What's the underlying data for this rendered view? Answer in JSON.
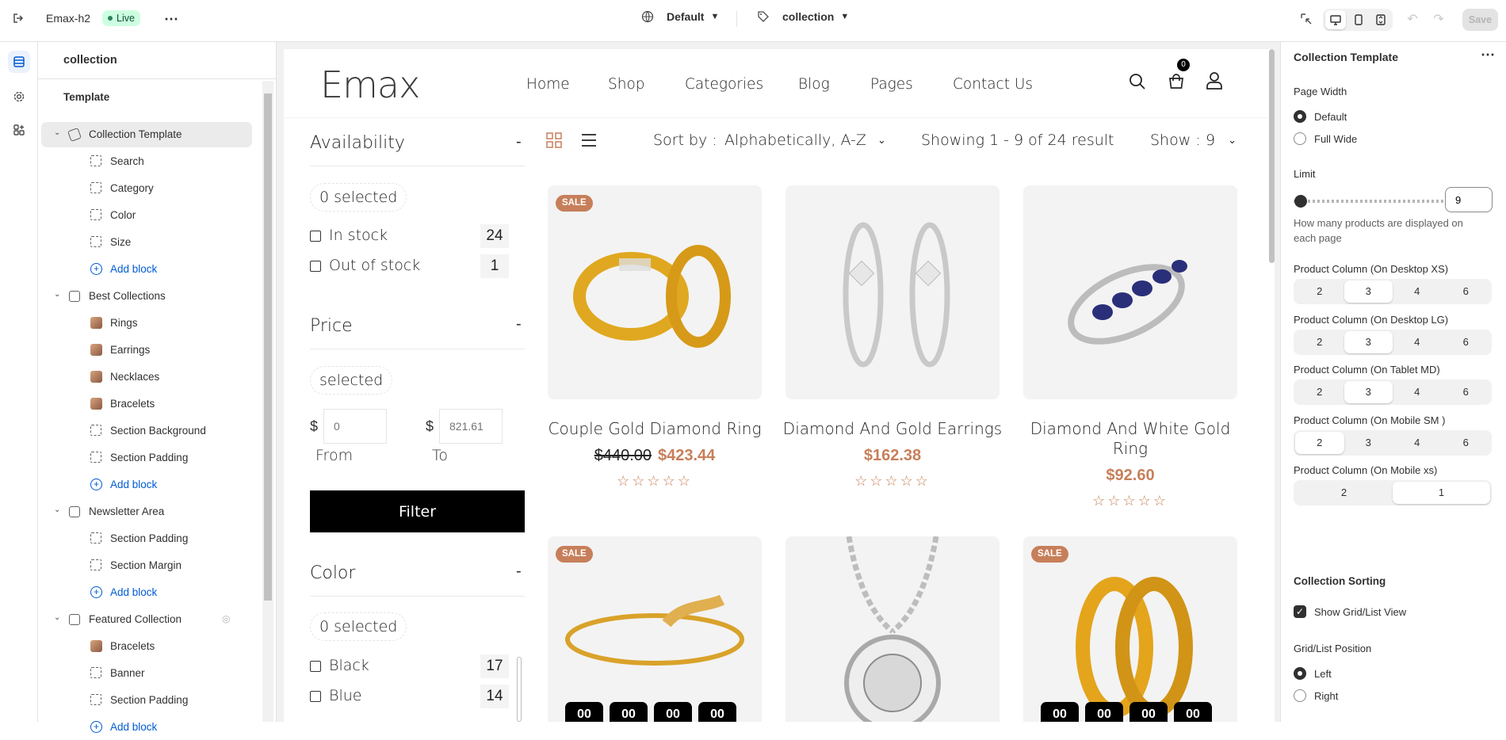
{
  "topbar": {
    "store_name": "Emax-h2",
    "live_badge": "Live",
    "theme_dropdown": "Default",
    "template_dropdown": "collection",
    "save_label": "Save"
  },
  "tree": {
    "header": "collection",
    "section_label": "Template",
    "items": [
      {
        "label": "Collection Template",
        "kind": "section"
      },
      {
        "label": "Search",
        "kind": "block"
      },
      {
        "label": "Category",
        "kind": "block"
      },
      {
        "label": "Color",
        "kind": "block"
      },
      {
        "label": "Size",
        "kind": "block"
      },
      {
        "label": "Add block",
        "kind": "add"
      },
      {
        "label": "Best Collections",
        "kind": "section"
      },
      {
        "label": "Rings",
        "kind": "thumb"
      },
      {
        "label": "Earrings",
        "kind": "thumb"
      },
      {
        "label": "Necklaces",
        "kind": "thumb"
      },
      {
        "label": "Bracelets",
        "kind": "thumb"
      },
      {
        "label": "Section Background",
        "kind": "block"
      },
      {
        "label": "Section Padding",
        "kind": "block"
      },
      {
        "label": "Add block",
        "kind": "add"
      },
      {
        "label": "Newsletter Area",
        "kind": "section"
      },
      {
        "label": "Section Padding",
        "kind": "block"
      },
      {
        "label": "Section Margin",
        "kind": "block"
      },
      {
        "label": "Add block",
        "kind": "add"
      },
      {
        "label": "Featured Collection",
        "kind": "section"
      },
      {
        "label": "Bracelets",
        "kind": "thumb"
      },
      {
        "label": "Banner",
        "kind": "block"
      },
      {
        "label": "Section Padding",
        "kind": "block"
      },
      {
        "label": "Add block",
        "kind": "add"
      }
    ]
  },
  "store": {
    "logo": "Emax",
    "nav": [
      "Home",
      "Shop",
      "Categories",
      "Blog",
      "Pages",
      "Contact Us"
    ],
    "cart_count": "0",
    "sort_label": "Sort by :",
    "sort_value": "Alphabetically, A-Z",
    "showing": "Showing 1 - 9 of 24 result",
    "show_label": "Show :",
    "show_value": "9",
    "filters": {
      "availability": {
        "title": "Availability",
        "toggle": "-",
        "selected": "0 selected",
        "options": [
          {
            "label": "In stock",
            "count": "24"
          },
          {
            "label": "Out of stock",
            "count": "1"
          }
        ]
      },
      "price": {
        "title": "Price",
        "toggle": "-",
        "selected": "selected",
        "currency": "$",
        "from_placeholder": "0",
        "to_placeholder": "821.61",
        "from_label": "From",
        "to_label": "To",
        "filter_button": "Filter"
      },
      "color": {
        "title": "Color",
        "toggle": "-",
        "selected": "0 selected",
        "options": [
          {
            "label": "Black",
            "count": "17"
          },
          {
            "label": "Blue",
            "count": "14"
          }
        ]
      }
    },
    "products": [
      {
        "title": "Couple Gold Diamond Ring",
        "old_price": "$440.00",
        "price": "$423.44",
        "sale": "SALE"
      },
      {
        "title": "Diamond And Gold Earrings",
        "old_price": "",
        "price": "$162.38",
        "sale": ""
      },
      {
        "title": "Diamond And White Gold Ring",
        "old_price": "",
        "price": "$92.60",
        "sale": ""
      }
    ],
    "row2_sale": "SALE",
    "stars": "☆☆☆☆☆",
    "timer": [
      "00",
      "00",
      "00",
      "00"
    ]
  },
  "panel": {
    "title": "Collection Template",
    "page_width_label": "Page Width",
    "page_width_options": [
      "Default",
      "Full Wide"
    ],
    "limit_label": "Limit",
    "limit_value": "9",
    "limit_level": 0.0,
    "limit_help": "How many products are displayed on each page",
    "columns": [
      {
        "label": "Product Column (On Desktop XS)",
        "options": [
          "2",
          "3",
          "4",
          "6"
        ],
        "selected": "3"
      },
      {
        "label": "Product Column (On Desktop LG)",
        "options": [
          "2",
          "3",
          "4",
          "6"
        ],
        "selected": "3"
      },
      {
        "label": "Product Column (On Tablet MD)",
        "options": [
          "2",
          "3",
          "4",
          "6"
        ],
        "selected": "3"
      },
      {
        "label": "Product Column (On Mobile SM )",
        "options": [
          "2",
          "3",
          "4",
          "6"
        ],
        "selected": "2"
      },
      {
        "label": "Product Column (On Mobile xs)",
        "options": [
          "2",
          "1"
        ],
        "selected": "1"
      }
    ],
    "sorting_title": "Collection Sorting",
    "show_grid_list": "Show Grid/List View",
    "grid_list_position": "Grid/List Position",
    "position_options": [
      "Left",
      "Right"
    ]
  },
  "colors": {
    "accent": "#c77f5a",
    "live": "#29845a",
    "link": "#005bd3"
  }
}
